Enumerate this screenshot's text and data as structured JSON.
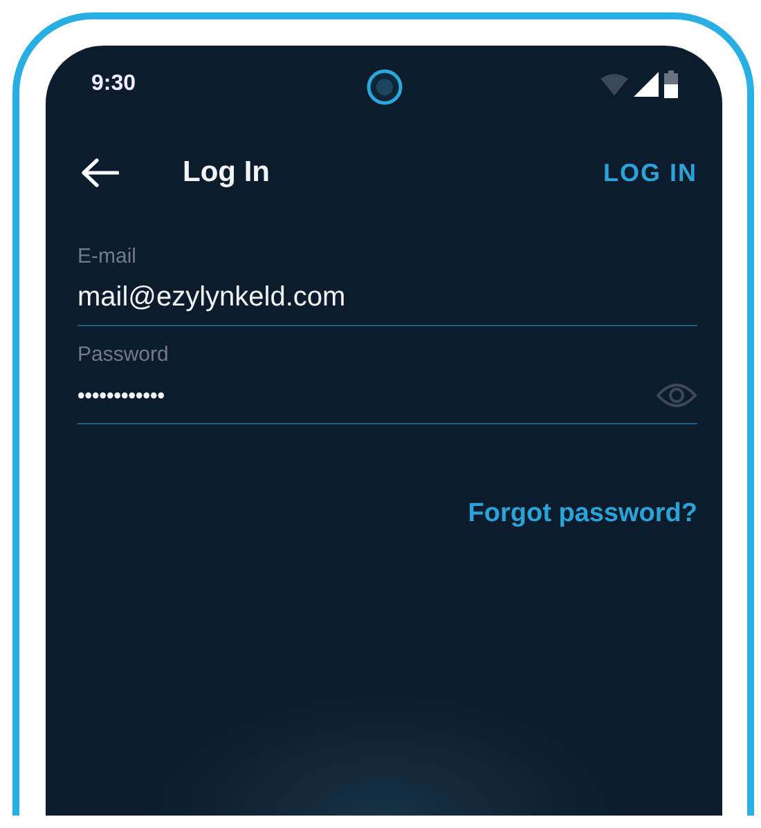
{
  "status_bar": {
    "time": "9:30"
  },
  "app_bar": {
    "title": "Log In",
    "action": "LOG IN"
  },
  "fields": [
    {
      "kind": "text",
      "label": "E-mail",
      "value": "mail@ezylynkeld.com"
    },
    {
      "kind": "password",
      "label": "Password",
      "value": "••••••••••••"
    }
  ],
  "forgot_link": "Forgot password?"
}
